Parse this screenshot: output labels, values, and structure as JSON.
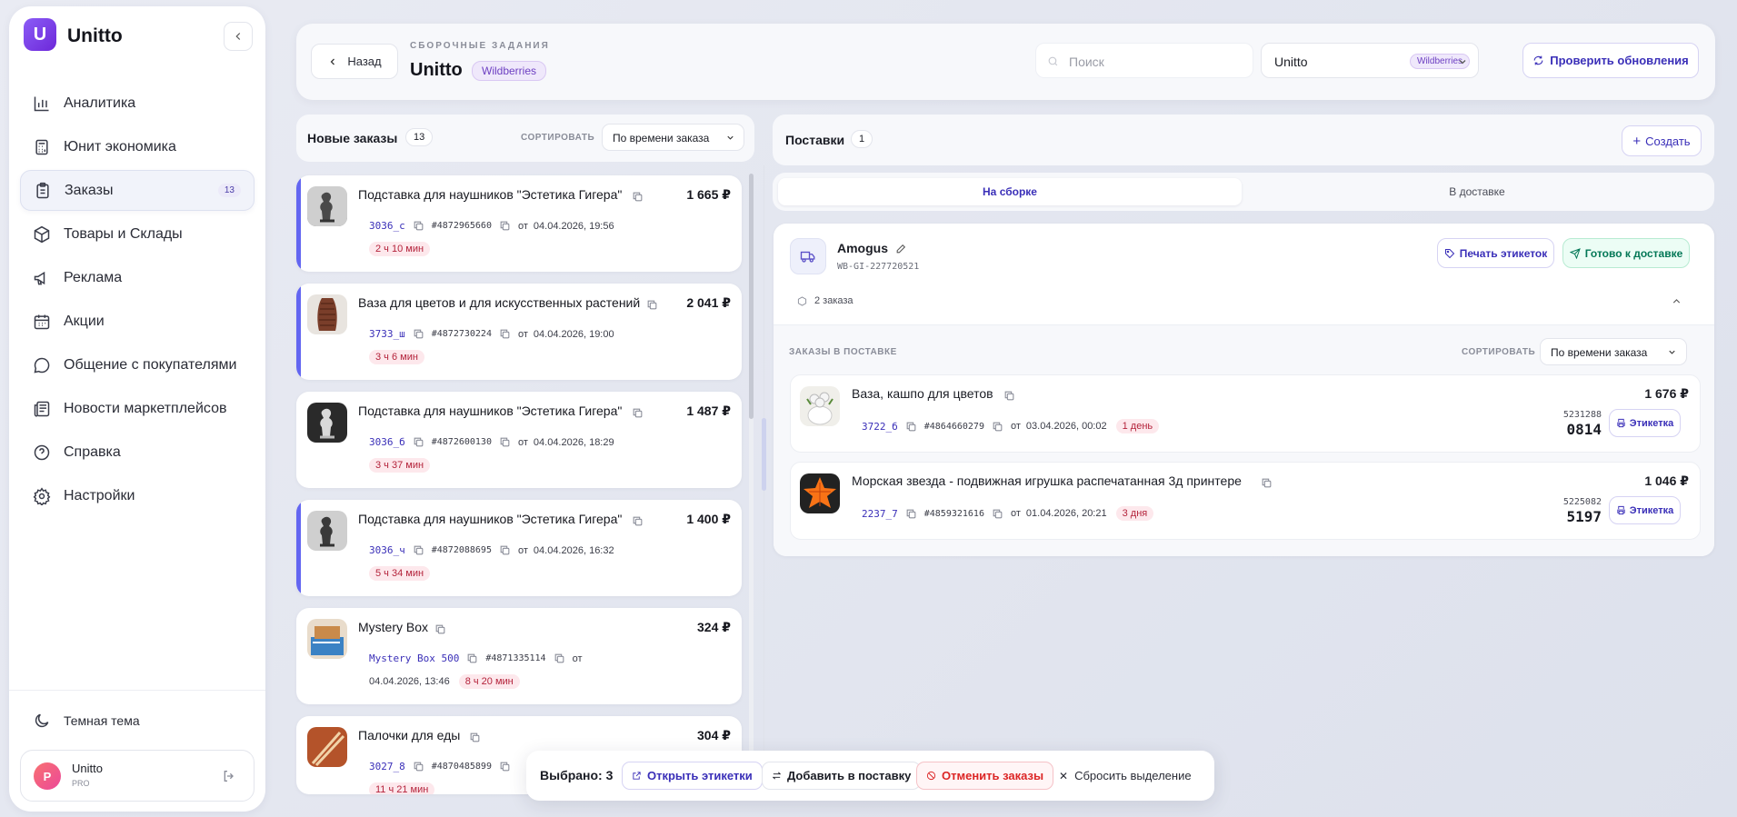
{
  "app": {
    "brand": "Unitto",
    "logo_letter": "U"
  },
  "sidebar": {
    "items": [
      {
        "label": "Аналитика",
        "icon": "bar-chart-icon"
      },
      {
        "label": "Юнит экономика",
        "icon": "calculator-icon"
      },
      {
        "label": "Заказы",
        "icon": "clipboard-icon",
        "badge": "13",
        "active": true
      },
      {
        "label": "Товары и Склады",
        "icon": "box-icon"
      },
      {
        "label": "Реклама",
        "icon": "megaphone-icon"
      },
      {
        "label": "Акции",
        "icon": "calendar-icon"
      },
      {
        "label": "Общение с покупателями",
        "icon": "chat-icon"
      },
      {
        "label": "Новости маркетплейсов",
        "icon": "newspaper-icon"
      },
      {
        "label": "Справка",
        "icon": "help-icon"
      },
      {
        "label": "Настройки",
        "icon": "gear-icon"
      }
    ],
    "theme_label": "Темная тема",
    "user": {
      "initial": "P",
      "name": "Unitto",
      "plan": "PRO"
    }
  },
  "header": {
    "back_label": "Назад",
    "subtitle": "СБОРОЧНЫЕ ЗАДАНИЯ",
    "title": "Unitto",
    "marketplace_tag": "Wildberries",
    "search_placeholder": "Поиск",
    "store_select": {
      "value": "Unitto",
      "tag": "Wildberries"
    },
    "check_updates_label": "Проверить обновления"
  },
  "new_orders": {
    "title": "Новые заказы",
    "count": "13",
    "sort_label": "СОРТИРОВАТЬ",
    "sort_value": "По времени заказа",
    "orders": [
      {
        "title": "Подставка для наушников \"Эстетика Гигера\"",
        "price": "1 665 ₽",
        "sku": "3036_с",
        "order_no": "#4872965660",
        "from": "от",
        "date": "04.04.2026, 19:56",
        "elapsed": "2 ч 10 мин",
        "selected": true
      },
      {
        "title": "Ваза для цветов и для искусственных растений",
        "price": "2 041 ₽",
        "sku": "3733_ш",
        "order_no": "#4872730224",
        "from": "от",
        "date": "04.04.2026, 19:00",
        "elapsed": "3 ч 6 мин",
        "selected": true
      },
      {
        "title": "Подставка для наушников \"Эстетика Гигера\"",
        "price": "1 487 ₽",
        "sku": "3036_б",
        "order_no": "#4872600130",
        "from": "от",
        "date": "04.04.2026, 18:29",
        "elapsed": "3 ч 37 мин",
        "selected": false
      },
      {
        "title": "Подставка для наушников \"Эстетика Гигера\"",
        "price": "1 400 ₽",
        "sku": "3036_ч",
        "order_no": "#4872088695",
        "from": "от",
        "date": "04.04.2026, 16:32",
        "elapsed": "5 ч 34 мин",
        "selected": true
      },
      {
        "title": "Mystery Box",
        "price": "324 ₽",
        "sku": "Mystery Box 500",
        "order_no": "#4871335114",
        "from": "от",
        "date": "04.04.2026, 13:46",
        "elapsed": "8 ч 20 мин",
        "selected": false
      },
      {
        "title": "Палочки для еды",
        "price": "304 ₽",
        "sku": "3027_8",
        "order_no": "#4870485899",
        "from": "",
        "date": "",
        "elapsed": "11 ч 21 мин",
        "selected": false
      }
    ]
  },
  "supplies": {
    "title": "Поставки",
    "count": "1",
    "create_label": "Создать",
    "tabs": [
      {
        "label": "На сборке",
        "active": true
      },
      {
        "label": "В доставке",
        "active": false
      }
    ],
    "supply": {
      "name": "Amogus",
      "code": "WB-GI-227720521",
      "print_label": "Печать этикеток",
      "ready_label": "Готово к доставке",
      "orders_count": "2 заказа",
      "section_title": "ЗАКАЗЫ В ПОСТАВКЕ",
      "sort_label": "СОРТИРОВАТЬ",
      "sort_value": "По времени заказа",
      "orders": [
        {
          "title": "Ваза, кашпо для цветов",
          "price": "1 676 ₽",
          "sku": "3722_б",
          "order_no": "#4864660279",
          "from": "от",
          "date": "03.04.2026, 00:02",
          "age": "1 день",
          "sticker_top": "5231288",
          "sticker_bottom": "0814",
          "label_btn": "Этикетка"
        },
        {
          "title": "Морская звезда - подвижная игрушка распечатанная 3д принтере",
          "price": "1 046 ₽",
          "sku": "2237_7",
          "order_no": "#4859321616",
          "from": "от",
          "date": "01.04.2026, 20:21",
          "age": "3 дня",
          "sticker_top": "5225082",
          "sticker_bottom": "5197",
          "label_btn": "Этикетка"
        }
      ]
    }
  },
  "selection_bar": {
    "selected": "Выбрано: 3",
    "open_labels": "Открыть этикетки",
    "add_to_supply": "Добавить в поставку",
    "cancel_orders": "Отменить заказы",
    "reset": "Сбросить выделение"
  },
  "colors": {
    "accent": "#6366f1",
    "brand": "#7c3aed",
    "danger": "#dc2626",
    "success": "#059669"
  }
}
